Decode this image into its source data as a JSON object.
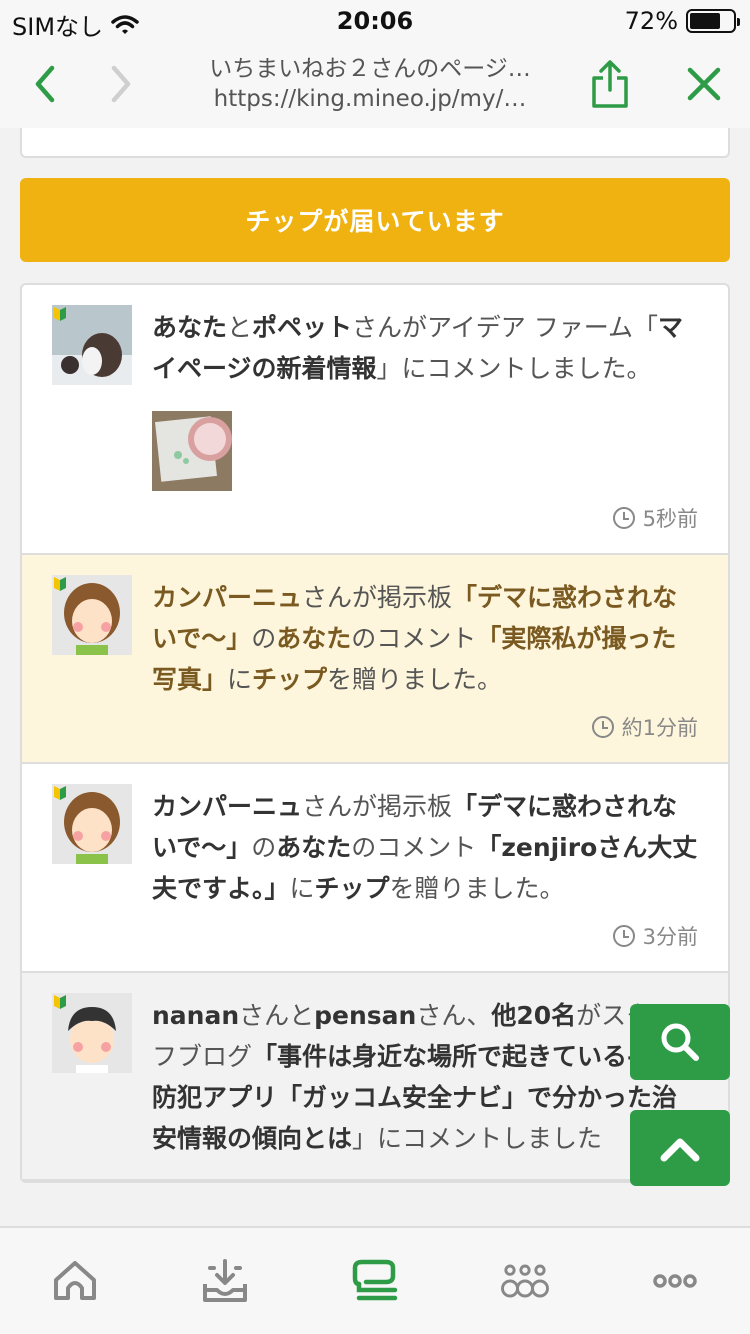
{
  "status_bar": {
    "carrier": "SIMなし",
    "time": "20:06",
    "battery": "72%",
    "battery_level": 0.72
  },
  "browser": {
    "title": "いちまいねお２さんのページ…",
    "url": "https://king.mineo.jp/my/…"
  },
  "tip_banner": "チップが届いています",
  "feed": [
    {
      "parts": [
        {
          "t": "あなた",
          "b": true
        },
        {
          "t": "と"
        },
        {
          "t": "ポペット",
          "b": true
        },
        {
          "t": "さんがアイデア ファーム「"
        },
        {
          "t": "マイページの新着情報",
          "b": true
        },
        {
          "t": "」にコメントしました。"
        }
      ],
      "has_thumbnail": true,
      "time": "5秒前",
      "style": "normal",
      "avatar": "penguin"
    },
    {
      "parts": [
        {
          "t": "カンパーニュ",
          "b": true
        },
        {
          "t": "さんが掲示板"
        },
        {
          "t": "「デマに惑わされないで〜」",
          "b": true
        },
        {
          "t": "の"
        },
        {
          "t": "あなた",
          "b": true
        },
        {
          "t": "のコメント"
        },
        {
          "t": "「実際私が撮った写真」",
          "b": true
        },
        {
          "t": "に"
        },
        {
          "t": "チップ",
          "b": true
        },
        {
          "t": "を贈りました。"
        }
      ],
      "has_thumbnail": false,
      "time": "約1分前",
      "style": "highlight",
      "avatar": "woman-brown"
    },
    {
      "parts": [
        {
          "t": "カンパーニュ",
          "b": true
        },
        {
          "t": "さんが掲示板"
        },
        {
          "t": "「デマに惑わされないで〜」",
          "b": true
        },
        {
          "t": "の"
        },
        {
          "t": "あなた",
          "b": true
        },
        {
          "t": "のコメント"
        },
        {
          "t": "「zenjiroさん大丈夫ですよ。」",
          "b": true
        },
        {
          "t": "に"
        },
        {
          "t": "チップ",
          "b": true
        },
        {
          "t": "を贈りました。"
        }
      ],
      "has_thumbnail": false,
      "time": "3分前",
      "style": "normal",
      "avatar": "woman-brown"
    },
    {
      "parts": [
        {
          "t": "nanan",
          "b": true
        },
        {
          "t": "さんと"
        },
        {
          "t": "pensan",
          "b": true
        },
        {
          "t": "さん、"
        },
        {
          "t": "他20名",
          "b": true
        },
        {
          "t": "がスタッフブログ"
        },
        {
          "t": "「事件は身近な場所で起きている——防犯アプリ「ガッコム安全ナビ」で分かった治安情報の傾向とは",
          "b": true
        },
        {
          "t": "」にコメントしました"
        }
      ],
      "has_thumbnail": false,
      "time": "",
      "style": "grey",
      "avatar": "man-dark"
    }
  ],
  "fab": {
    "search_icon": "search-icon",
    "top_icon": "chevron-up-icon"
  },
  "tabbar": [
    "home-icon",
    "inbox-download-icon",
    "chat-icon",
    "community-icon",
    "more-icon"
  ],
  "colors": {
    "accent": "#2e9c47",
    "banner": "#f0b210",
    "highlight": "#fdf6dc"
  }
}
